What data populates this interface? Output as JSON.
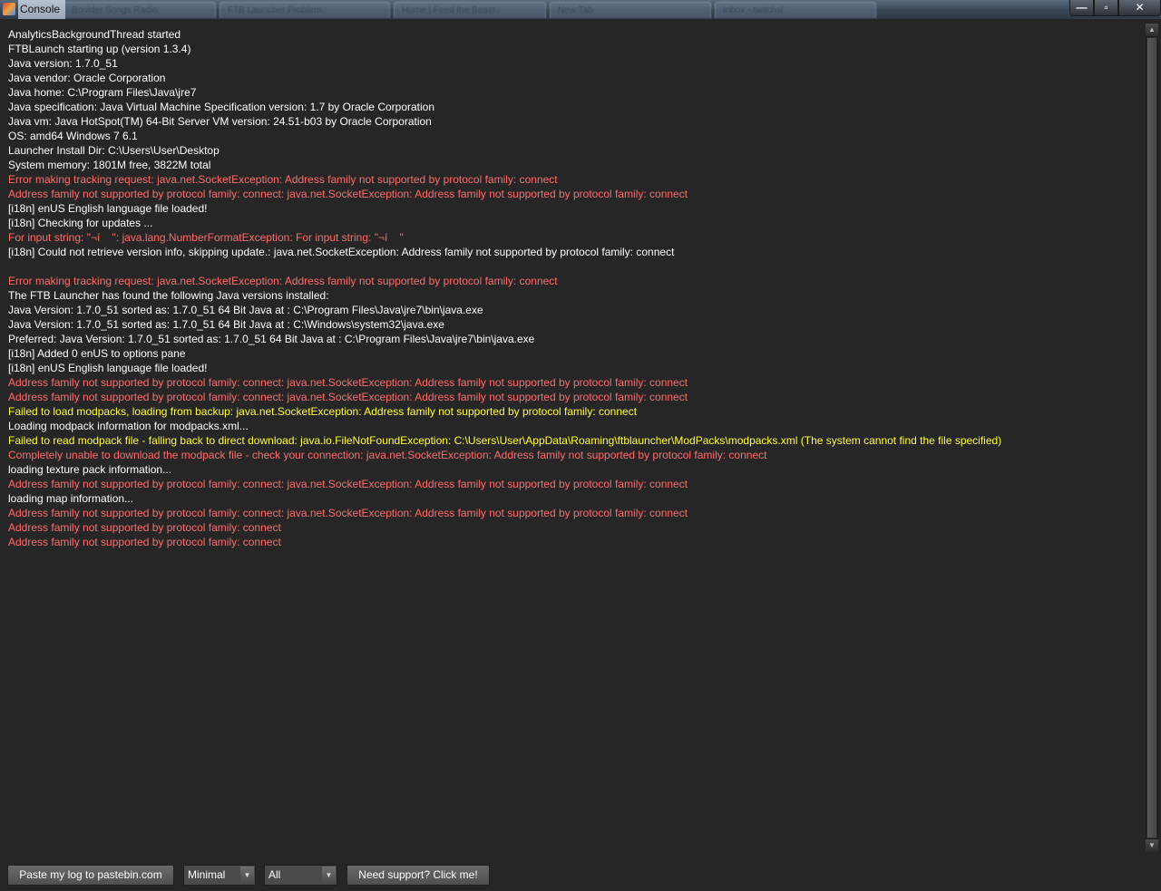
{
  "window": {
    "title": "Console",
    "background_tabs": [
      "Boulder Songs Radio",
      "FTB Launcher Problem",
      "Home | Feed the Beast",
      "New Tab",
      "Inbox - twitchsf",
      ""
    ],
    "controls": {
      "minimize": "—",
      "maximize": "▫",
      "close": "✕"
    }
  },
  "colors": {
    "background": "#262626",
    "normal_text": "#ffffff",
    "error_text": "#ff6b6b",
    "warning_text": "#ffff3d"
  },
  "log": {
    "lines": [
      {
        "text": "AnalyticsBackgroundThread started",
        "level": "info"
      },
      {
        "text": "FTBLaunch starting up (version 1.3.4)",
        "level": "info"
      },
      {
        "text": "Java version: 1.7.0_51",
        "level": "info"
      },
      {
        "text": "Java vendor: Oracle Corporation",
        "level": "info"
      },
      {
        "text": "Java home: C:\\Program Files\\Java\\jre7",
        "level": "info"
      },
      {
        "text": "Java specification: Java Virtual Machine Specification version: 1.7 by Oracle Corporation",
        "level": "info"
      },
      {
        "text": "Java vm: Java HotSpot(TM) 64-Bit Server VM version: 24.51-b03 by Oracle Corporation",
        "level": "info"
      },
      {
        "text": "OS: amd64 Windows 7 6.1",
        "level": "info"
      },
      {
        "text": "Launcher Install Dir: C:\\Users\\User\\Desktop",
        "level": "info"
      },
      {
        "text": "System memory: 1801M free, 3822M total",
        "level": "info"
      },
      {
        "text": "Error making tracking request: java.net.SocketException: Address family not supported by protocol family: connect",
        "level": "error"
      },
      {
        "text": "Address family not supported by protocol family: connect: java.net.SocketException: Address family not supported by protocol family: connect",
        "level": "error"
      },
      {
        "text": "[i18n] enUS English language file loaded!",
        "level": "info"
      },
      {
        "text": "[i18n] Checking for updates ...",
        "level": "info"
      },
      {
        "text": "For input string: \"¬í    \": java.lang.NumberFormatException: For input string: \"¬í    \"",
        "level": "error"
      },
      {
        "text": "[i18n] Could not retrieve version info, skipping update.: java.net.SocketException: Address family not supported by protocol family: connect",
        "level": "info"
      },
      {
        "text": "",
        "level": "info"
      },
      {
        "text": "Error making tracking request: java.net.SocketException: Address family not supported by protocol family: connect",
        "level": "error"
      },
      {
        "text": "The FTB Launcher has found the following Java versions installed:",
        "level": "info"
      },
      {
        "text": "Java Version: 1.7.0_51 sorted as: 1.7.0_51 64 Bit Java at : C:\\Program Files\\Java\\jre7\\bin\\java.exe",
        "level": "info"
      },
      {
        "text": "Java Version: 1.7.0_51 sorted as: 1.7.0_51 64 Bit Java at : C:\\Windows\\system32\\java.exe",
        "level": "info"
      },
      {
        "text": "Preferred: Java Version: 1.7.0_51 sorted as: 1.7.0_51 64 Bit Java at : C:\\Program Files\\Java\\jre7\\bin\\java.exe",
        "level": "info"
      },
      {
        "text": "[i18n] Added 0 enUS to options pane",
        "level": "info"
      },
      {
        "text": "[i18n] enUS English language file loaded!",
        "level": "info"
      },
      {
        "text": "Address family not supported by protocol family: connect: java.net.SocketException: Address family not supported by protocol family: connect",
        "level": "error"
      },
      {
        "text": "Address family not supported by protocol family: connect: java.net.SocketException: Address family not supported by protocol family: connect",
        "level": "error"
      },
      {
        "text": "Failed to load modpacks, loading from backup: java.net.SocketException: Address family not supported by protocol family: connect",
        "level": "warn"
      },
      {
        "text": "Loading modpack information for modpacks.xml...",
        "level": "info"
      },
      {
        "text": "Failed to read modpack file - falling back to direct download: java.io.FileNotFoundException: C:\\Users\\User\\AppData\\Roaming\\ftblauncher\\ModPacks\\modpacks.xml (The system cannot find the file specified)",
        "level": "warn"
      },
      {
        "text": "Completely unable to download the modpack file - check your connection: java.net.SocketException: Address family not supported by protocol family: connect",
        "level": "error"
      },
      {
        "text": "loading texture pack information...",
        "level": "info"
      },
      {
        "text": "Address family not supported by protocol family: connect: java.net.SocketException: Address family not supported by protocol family: connect",
        "level": "error"
      },
      {
        "text": "loading map information...",
        "level": "info"
      },
      {
        "text": "Address family not supported by protocol family: connect: java.net.SocketException: Address family not supported by protocol family: connect",
        "level": "error"
      },
      {
        "text": "Address family not supported by protocol family: connect",
        "level": "error"
      },
      {
        "text": "Address family not supported by protocol family: connect",
        "level": "error"
      }
    ]
  },
  "toolbar": {
    "paste_button": "Paste my log to pastebin.com",
    "level_select": "Minimal",
    "filter_select": "All",
    "support_button": "Need support? Click me!"
  },
  "scrollbar": {
    "up_arrow": "▲",
    "down_arrow": "▼"
  }
}
